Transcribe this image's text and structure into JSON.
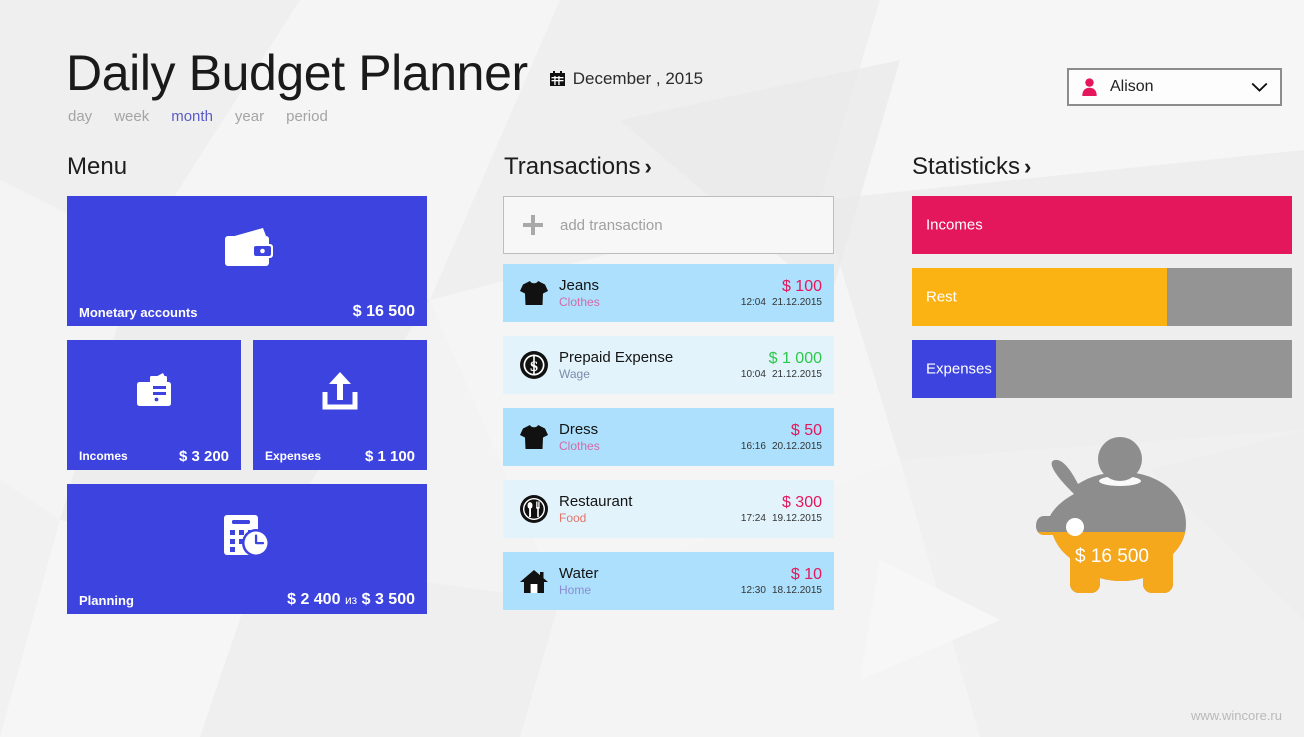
{
  "app": {
    "title": "Daily Budget Planner",
    "date": "December , 2015",
    "calendar_icon": "calendar-icon",
    "footer_url": "www.wincore.ru"
  },
  "periods": {
    "active": "month",
    "items": [
      {
        "label": "day"
      },
      {
        "label": "week"
      },
      {
        "label": "month"
      },
      {
        "label": "year"
      },
      {
        "label": "period"
      }
    ]
  },
  "user": {
    "name": "Alison",
    "icon": "user-icon",
    "chevron": "chevron-down-icon",
    "accent": "#E4175C"
  },
  "menu": {
    "heading": "Menu",
    "tile_color": "#3C43DF",
    "tiles": [
      {
        "name": "monetary-accounts",
        "label": "Monetary accounts",
        "value": "$ 16 500",
        "icon": "wallet-icon"
      },
      {
        "name": "incomes",
        "label": "Incomes",
        "value": "$ 3 200",
        "icon": "wallet-money-icon"
      },
      {
        "name": "expenses",
        "label": "Expenses",
        "value": "$ 1 100",
        "icon": "upload-arrow-icon"
      },
      {
        "name": "planning",
        "label": "Planning",
        "value": "$ 2 400",
        "value_separator": "из",
        "value_total": "$ 3 500",
        "icon": "calendar-clock-icon"
      }
    ]
  },
  "transactions": {
    "heading": "Transactions",
    "arrow": "›",
    "add": {
      "label": "add transaction",
      "icon": "plus-icon"
    },
    "row_colors": {
      "odd": "#ACE0FC",
      "even": "#E2F3FB"
    },
    "items": [
      {
        "name": "Jeans",
        "category": "Clothes",
        "category_color": "#D46BA8",
        "amount": "$ 100",
        "amount_color": "#E4175C",
        "time": "12:04",
        "date": "21.12.2015",
        "icon": "tshirt-icon"
      },
      {
        "name": "Prepaid Expense",
        "category": "Wage",
        "category_color": "#7C8CA8",
        "amount": "$ 1 000",
        "amount_color": "#2CC84B",
        "time": "10:04",
        "date": "21.12.2015",
        "icon": "dollar-coin-icon"
      },
      {
        "name": "Dress",
        "category": "Clothes",
        "category_color": "#D46BA8",
        "amount": "$ 50",
        "amount_color": "#E4175C",
        "time": "16:16",
        "date": "20.12.2015",
        "icon": "tshirt-icon"
      },
      {
        "name": "Restaurant",
        "category": "Food",
        "category_color": "#E2766B",
        "amount": "$ 300",
        "amount_color": "#E4175C",
        "time": "17:24",
        "date": "19.12.2015",
        "icon": "restaurant-icon"
      },
      {
        "name": "Water",
        "category": "Home",
        "category_color": "#8B8BD0",
        "amount": "$ 10",
        "amount_color": "#E4175C",
        "time": "12:30",
        "date": "18.12.2015",
        "icon": "home-icon"
      }
    ]
  },
  "statistics": {
    "heading": "Statisticks",
    "arrow": "›",
    "track_color": "#949494",
    "bars": [
      {
        "label": "Incomes",
        "percent": 100,
        "color": "#E4175C"
      },
      {
        "label": "Rest",
        "percent": 67,
        "color": "#FBB313"
      },
      {
        "label": "Expenses",
        "percent": 22,
        "color": "#3C43DF"
      }
    ],
    "piggy": {
      "amount": "$ 16 500",
      "fill_percent": 60,
      "fill_color": "#F5A81C",
      "empty_color": "#8D8D8D",
      "icon": "piggy-bank-icon"
    }
  },
  "chart_data": {
    "type": "bar",
    "title": "Statisticks",
    "categories": [
      "Incomes",
      "Rest",
      "Expenses"
    ],
    "values": [
      100,
      67,
      22
    ],
    "colors": [
      "#E4175C",
      "#FBB313",
      "#3C43DF"
    ],
    "xlabel": "",
    "ylabel": "",
    "ylim": [
      0,
      100
    ],
    "orientation": "horizontal",
    "grid": false,
    "legend": "none",
    "annotations": [
      {
        "label": "Monetary accounts",
        "value": 16500,
        "unit": "$"
      },
      {
        "label": "Incomes",
        "value": 3200,
        "unit": "$"
      },
      {
        "label": "Expenses",
        "value": 1100,
        "unit": "$"
      },
      {
        "label": "Planning spent",
        "value": 2400,
        "unit": "$"
      },
      {
        "label": "Planning total",
        "value": 3500,
        "unit": "$"
      },
      {
        "label": "Piggy balance",
        "value": 16500,
        "unit": "$"
      }
    ]
  }
}
